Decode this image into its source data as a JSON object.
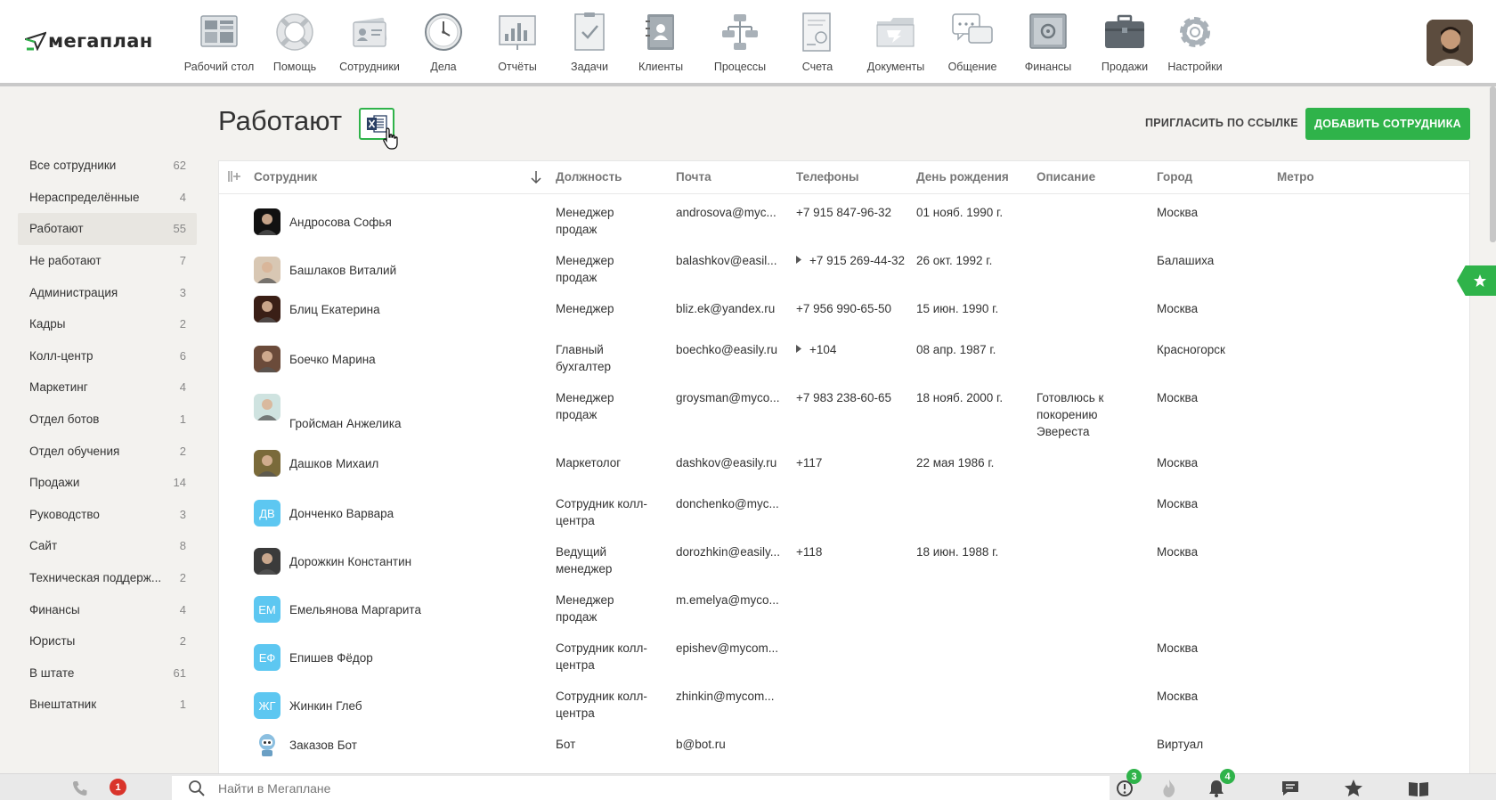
{
  "brand": {
    "name": "мегаплан"
  },
  "nav": [
    {
      "label": "Рабочий стол",
      "icon": "desktop-icon"
    },
    {
      "label": "Помощь",
      "icon": "lifebuoy-icon"
    },
    {
      "label": "Сотрудники",
      "icon": "employees-icon"
    },
    {
      "label": "Дела",
      "icon": "clock-icon"
    },
    {
      "label": "Отчёты",
      "icon": "reports-icon"
    },
    {
      "label": "Задачи",
      "icon": "tasks-icon"
    },
    {
      "label": "Клиенты",
      "icon": "clients-icon"
    },
    {
      "label": "Процессы",
      "icon": "processes-icon"
    },
    {
      "label": "Счета",
      "icon": "invoices-icon"
    },
    {
      "label": "Документы",
      "icon": "documents-icon"
    },
    {
      "label": "Общение",
      "icon": "chat-icon"
    },
    {
      "label": "Финансы",
      "icon": "safe-icon"
    },
    {
      "label": "Продажи",
      "icon": "briefcase-icon"
    },
    {
      "label": "Настройки",
      "icon": "gear-icon"
    }
  ],
  "sidebar": {
    "items": [
      {
        "label": "Все сотрудники",
        "count": "62"
      },
      {
        "label": "Нераспределённые",
        "count": "4"
      },
      {
        "label": "Работают",
        "count": "55",
        "active": true
      },
      {
        "label": "Не работают",
        "count": "7"
      },
      {
        "label": "Администрация",
        "count": "3"
      },
      {
        "label": "Кадры",
        "count": "2"
      },
      {
        "label": "Колл-центр",
        "count": "6"
      },
      {
        "label": "Маркетинг",
        "count": "4"
      },
      {
        "label": "Отдел ботов",
        "count": "1"
      },
      {
        "label": "Отдел обучения",
        "count": "2"
      },
      {
        "label": "Продажи",
        "count": "14"
      },
      {
        "label": "Руководство",
        "count": "3"
      },
      {
        "label": "Сайт",
        "count": "8"
      },
      {
        "label": "Техническая поддерж...",
        "count": "2"
      },
      {
        "label": "Финансы",
        "count": "4"
      },
      {
        "label": "Юристы",
        "count": "2"
      },
      {
        "label": "В штате",
        "count": "61"
      },
      {
        "label": "Внештатник",
        "count": "1"
      }
    ]
  },
  "header": {
    "title": "Работают",
    "invite_label": "ПРИГЛАСИТЬ ПО ССЫЛКЕ",
    "add_label": "ДОБАВИТЬ СОТРУДНИКА"
  },
  "table": {
    "columns": [
      "Сотрудник",
      "Должность",
      "Почта",
      "Телефоны",
      "День рождения",
      "Описание",
      "Город",
      "Метро"
    ],
    "rows": [
      {
        "name": "Андросова Софья",
        "position": [
          "Менеджер",
          "продаж"
        ],
        "email": "androsova@myc...",
        "phone": "+7 915 847-96-32",
        "birthday": "01 нояб. 1990 г.",
        "description": [],
        "city": "Москва",
        "avatar": "photo",
        "tint": "#111"
      },
      {
        "name": "Башлаков Виталий",
        "position": [
          "Менеджер",
          "продаж"
        ],
        "email": "balashkov@easil...",
        "phone": "+7 915 269-44-32",
        "phone_expand": true,
        "birthday": "26 окт. 1992 г.",
        "description": [],
        "city": "Балашиха",
        "avatar": "photo",
        "tint": "#d8c7b3"
      },
      {
        "name": "Блиц Екатерина",
        "position": [
          "Менеджер"
        ],
        "email": "bliz.ek@yandex.ru",
        "phone": "+7 956 990-65-50",
        "birthday": "15 июн. 1990 г.",
        "description": [],
        "city": "Москва",
        "avatar": "photo",
        "tint": "#3a1f16"
      },
      {
        "name": "Боечко Марина",
        "position": [
          "Главный",
          "бухгалтер"
        ],
        "email": "boechko@easily.ru",
        "phone": "+104",
        "phone_expand": true,
        "birthday": "08 апр. 1987 г.",
        "description": [],
        "city": "Красногорск",
        "avatar": "photo",
        "tint": "#6b4b3a"
      },
      {
        "name": "Гройсман Анжелика",
        "position": [
          "Менеджер",
          "продаж"
        ],
        "email": "groysman@myco...",
        "phone": "+7 983 238-60-65",
        "birthday": "18 нояб. 2000 г.",
        "description": [
          "Готовлюсь к",
          "покорению",
          "Эвереста"
        ],
        "city": "Москва",
        "avatar": "photo",
        "tint": "#cfe3e0"
      },
      {
        "name": "Дашков Михаил",
        "position": [
          "Маркетолог"
        ],
        "email": "dashkov@easily.ru",
        "phone": "+117",
        "birthday": "22 мая 1986 г.",
        "description": [],
        "city": "Москва",
        "avatar": "photo",
        "tint": "#7a6a3a"
      },
      {
        "name": "Донченко Варвара",
        "position": [
          "Сотрудник колл-",
          "центра"
        ],
        "email": "donchenko@myc...",
        "phone": "",
        "birthday": "",
        "description": [],
        "city": "Москва",
        "avatar": "ДВ"
      },
      {
        "name": "Дорожкин Константин",
        "position": [
          "Ведущий",
          "менеджер"
        ],
        "email": "dorozhkin@easily...",
        "phone": "+118",
        "birthday": "18 июн. 1988 г.",
        "description": [],
        "city": "Москва",
        "avatar": "photo",
        "tint": "#3b3b3b"
      },
      {
        "name": "Емельянова Маргарита",
        "position": [
          "Менеджер",
          "продаж"
        ],
        "email": "m.emelya@myco...",
        "phone": "",
        "birthday": "",
        "description": [],
        "city": "",
        "avatar": "ЕМ"
      },
      {
        "name": "Епишев Фёдор",
        "position": [
          "Сотрудник колл-",
          "центра"
        ],
        "email": "epishev@mycom...",
        "phone": "",
        "birthday": "",
        "description": [],
        "city": "Москва",
        "avatar": "ЕФ"
      },
      {
        "name": "Жинкин Глеб",
        "position": [
          "Сотрудник колл-",
          "центра"
        ],
        "email": "zhinkin@mycom...",
        "phone": "",
        "birthday": "",
        "description": [],
        "city": "Москва",
        "avatar": "ЖГ"
      },
      {
        "name": "Заказов Бот",
        "position": [
          "Бот"
        ],
        "email": "b@bot.ru",
        "phone": "",
        "birthday": "",
        "description": [],
        "city": "Виртуал",
        "avatar": "bot"
      }
    ]
  },
  "bottom": {
    "search_placeholder": "Найти в Мегаплане",
    "call_badge": "1",
    "alert_badge": "3",
    "notify_badge": "4"
  }
}
